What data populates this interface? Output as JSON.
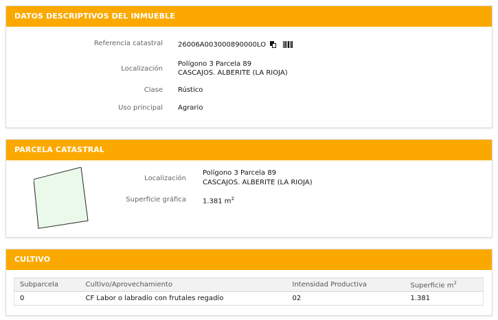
{
  "datos": {
    "title": "DATOS DESCRIPTIVOS DEL INMUEBLE",
    "referencia_label": "Referencia catastral",
    "referencia_value": "26006A003000890000LO",
    "localizacion_label": "Localización",
    "localizacion_line1": "Polígono 3 Parcela 89",
    "localizacion_line2": "CASCAJOS. ALBERITE (LA RIOJA)",
    "clase_label": "Clase",
    "clase_value": "Rústico",
    "uso_label": "Uso principal",
    "uso_value": "Agrario"
  },
  "parcela": {
    "title": "PARCELA CATASTRAL",
    "localizacion_label": "Localización",
    "localizacion_line1": "Polígono 3 Parcela 89",
    "localizacion_line2": "CASCAJOS. ALBERITE (LA RIOJA)",
    "superficie_label": "Superficie gráfica",
    "superficie_value": "1.381 m",
    "superficie_unit_exp": "2"
  },
  "cultivo": {
    "title": "CULTIVO",
    "headers": {
      "subparcela": "Subparcela",
      "cultivo": "Cultivo/Aprovechamiento",
      "intensidad": "Intensidad Productiva",
      "superficie": "Superficie m",
      "superficie_exp": "2"
    },
    "rows": [
      {
        "subparcela": "0",
        "cultivo": "CF Labor o labradío con frutales regadío",
        "intensidad": "02",
        "superficie": "1.381"
      }
    ]
  },
  "colors": {
    "header_bg": "#fba900",
    "parcel_fill": "#eaf9ea"
  }
}
